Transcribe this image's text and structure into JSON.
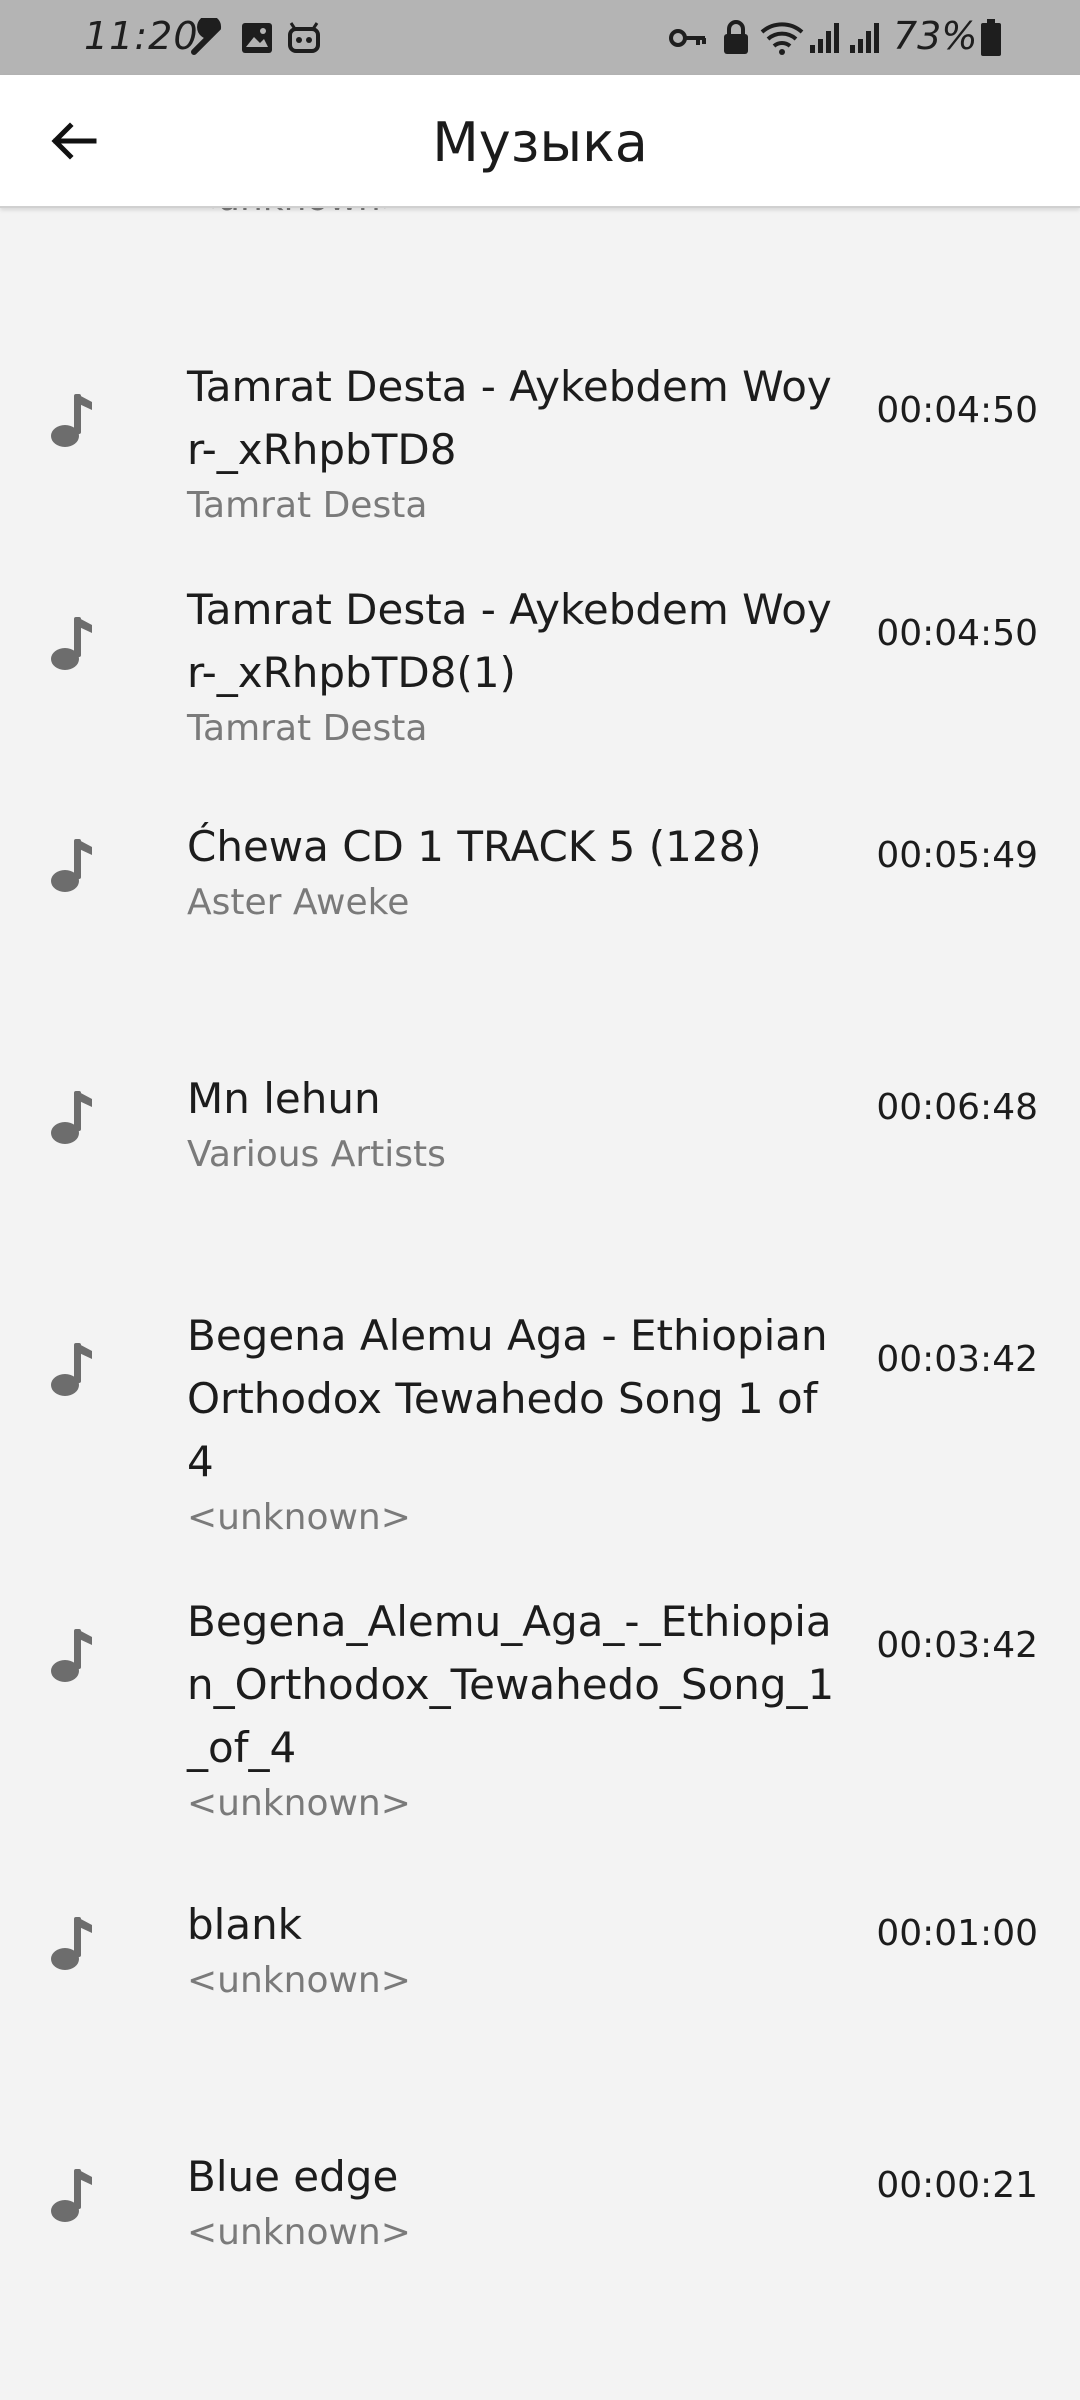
{
  "status_bar": {
    "time": "11:20",
    "battery_percent": "73%",
    "icons": [
      "tool-icon",
      "image-icon",
      "robot-icon",
      "key-icon",
      "lock-icon",
      "wifi-icon",
      "signal-icon",
      "signal-icon",
      "battery-icon"
    ]
  },
  "app_bar": {
    "title": "Музыка",
    "back_icon": "arrow-left-icon"
  },
  "partial_item": {
    "artist": "<unknown>"
  },
  "tracks": [
    {
      "title": "Tamrat Desta - Aykebdem Woy r-_xRhpbTD8",
      "artist": "Tamrat Desta",
      "duration": "00:04:50"
    },
    {
      "title": "Tamrat Desta - Aykebdem Woy r-_xRhpbTD8(1)",
      "artist": "Tamrat Desta",
      "duration": "00:04:50"
    },
    {
      "title": "Ćhewa CD 1 TRACK 5 (128)",
      "artist": "Aster Aweke",
      "duration": "00:05:49"
    },
    {
      "title": "Mn lehun",
      "artist": "Various Artists",
      "duration": "00:06:48"
    },
    {
      "title": "Begena Alemu Aga - Ethiopian Orthodox Tewahedo Song 1 of 4",
      "artist": "<unknown>",
      "duration": "00:03:42"
    },
    {
      "title": "Begena_Alemu_Aga_-_Ethiopian_Orthodox_Tewahedo_Song_1_of_4",
      "artist": "<unknown>",
      "duration": "00:03:42"
    },
    {
      "title": "blank",
      "artist": "<unknown>",
      "duration": "00:01:00"
    },
    {
      "title": "Blue edge",
      "artist": "<unknown>",
      "duration": "00:00:21"
    }
  ],
  "colors": {
    "status_bar_bg": "#b4b4b4",
    "app_bar_bg": "#ffffff",
    "list_bg": "#f3f3f3",
    "note_icon": "#6d6d6d",
    "secondary_text": "#7a7a7a"
  }
}
